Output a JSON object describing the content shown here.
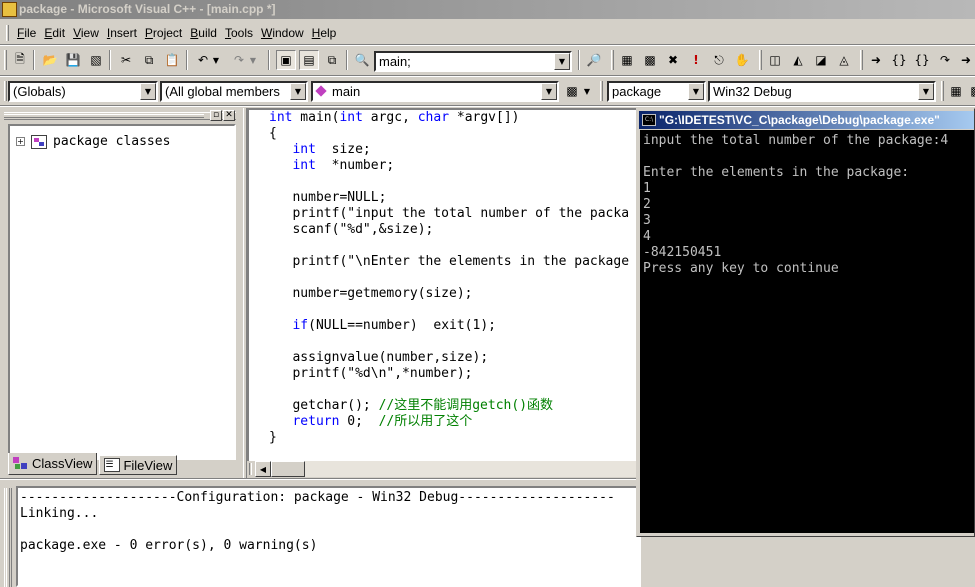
{
  "window": {
    "title": "package - Microsoft Visual C++ - [main.cpp *]"
  },
  "menu": [
    {
      "hot": "F",
      "rest": "ile"
    },
    {
      "hot": "E",
      "rest": "dit"
    },
    {
      "hot": "V",
      "rest": "iew"
    },
    {
      "hot": "I",
      "rest": "nsert"
    },
    {
      "hot": "P",
      "rest": "roject"
    },
    {
      "hot": "B",
      "rest": "uild"
    },
    {
      "hot": "T",
      "rest": "ools"
    },
    {
      "hot": "W",
      "rest": "indow"
    },
    {
      "hot": "H",
      "rest": "elp"
    }
  ],
  "toolbar": {
    "find_value": "main;",
    "scope_combo": "(Globals)",
    "members_combo": "(All global members",
    "function_combo": "main",
    "project_combo": "package",
    "config_combo": "Win32 Debug"
  },
  "workspace": {
    "tree_root": "package classes",
    "tabs": [
      "ClassView",
      "FileView"
    ]
  },
  "editor": {
    "lines": [
      {
        "p": [
          [
            "k",
            "int"
          ],
          [
            "t",
            " main("
          ],
          [
            "k",
            "int"
          ],
          [
            "t",
            " argc, "
          ],
          [
            "k",
            "char"
          ],
          [
            "t",
            " *argv[])"
          ]
        ]
      },
      {
        "p": [
          [
            "t",
            "{"
          ]
        ]
      },
      {
        "p": [
          [
            "t",
            "   "
          ],
          [
            "k",
            "int"
          ],
          [
            "t",
            "  size;"
          ]
        ]
      },
      {
        "p": [
          [
            "t",
            "   "
          ],
          [
            "k",
            "int"
          ],
          [
            "t",
            "  *number;"
          ]
        ]
      },
      {
        "p": [
          [
            "t",
            ""
          ]
        ]
      },
      {
        "p": [
          [
            "t",
            "   number=NULL;"
          ]
        ]
      },
      {
        "p": [
          [
            "t",
            "   printf(\"input the total number of the packa"
          ]
        ]
      },
      {
        "p": [
          [
            "t",
            "   scanf(\"%d\",&size);"
          ]
        ]
      },
      {
        "p": [
          [
            "t",
            ""
          ]
        ]
      },
      {
        "p": [
          [
            "t",
            "   printf(\"\\nEnter the elements in the package"
          ]
        ]
      },
      {
        "p": [
          [
            "t",
            ""
          ]
        ]
      },
      {
        "p": [
          [
            "t",
            "   number=getmemory(size);"
          ]
        ]
      },
      {
        "p": [
          [
            "t",
            ""
          ]
        ]
      },
      {
        "p": [
          [
            "t",
            "   "
          ],
          [
            "k",
            "if"
          ],
          [
            "t",
            "(NULL==number)  exit(1);"
          ]
        ]
      },
      {
        "p": [
          [
            "t",
            ""
          ]
        ]
      },
      {
        "p": [
          [
            "t",
            "   assignvalue(number,size);"
          ]
        ]
      },
      {
        "p": [
          [
            "t",
            "   printf(\"%d\\n\",*number);"
          ]
        ]
      },
      {
        "p": [
          [
            "t",
            ""
          ]
        ]
      },
      {
        "p": [
          [
            "t",
            "   getchar(); "
          ],
          [
            "c",
            "//这里不能调用getch()函数"
          ]
        ]
      },
      {
        "p": [
          [
            "t",
            "   "
          ],
          [
            "k",
            "return"
          ],
          [
            "t",
            " 0;  "
          ],
          [
            "c",
            "//所以用了这个"
          ]
        ]
      },
      {
        "p": [
          [
            "t",
            "}"
          ]
        ]
      }
    ]
  },
  "output": {
    "lines": [
      "--------------------Configuration: package - Win32 Debug--------------------",
      "Linking...",
      "",
      "package.exe - 0 error(s), 0 warning(s)"
    ]
  },
  "console": {
    "title": "\"G:\\IDETEST\\VC_C\\package\\Debug\\package.exe\"",
    "lines": [
      "input the total number of the package:4",
      "",
      "Enter the elements in the package:",
      "1",
      "2",
      "3",
      "4",
      "-842150451",
      "Press any key to continue"
    ]
  },
  "colors": {
    "keyword": "#0000ff",
    "comment": "#008000",
    "title_active": "#0a246a",
    "title_inactive": "#808080"
  },
  "icons": [
    "new-file-icon",
    "open-folder-icon",
    "save-icon",
    "save-all-icon",
    "cut-icon",
    "copy-icon",
    "paste-icon",
    "undo-icon",
    "redo-icon",
    "workspace-icon",
    "output-window-icon",
    "window-list-icon",
    "find-in-files-icon",
    "find-icon",
    "compile-icon",
    "build-icon",
    "stop-build-icon",
    "execute-icon",
    "go-icon",
    "breakpoint-icon",
    "class-wizard-icon",
    "step-into-icon",
    "step-over-icon"
  ]
}
